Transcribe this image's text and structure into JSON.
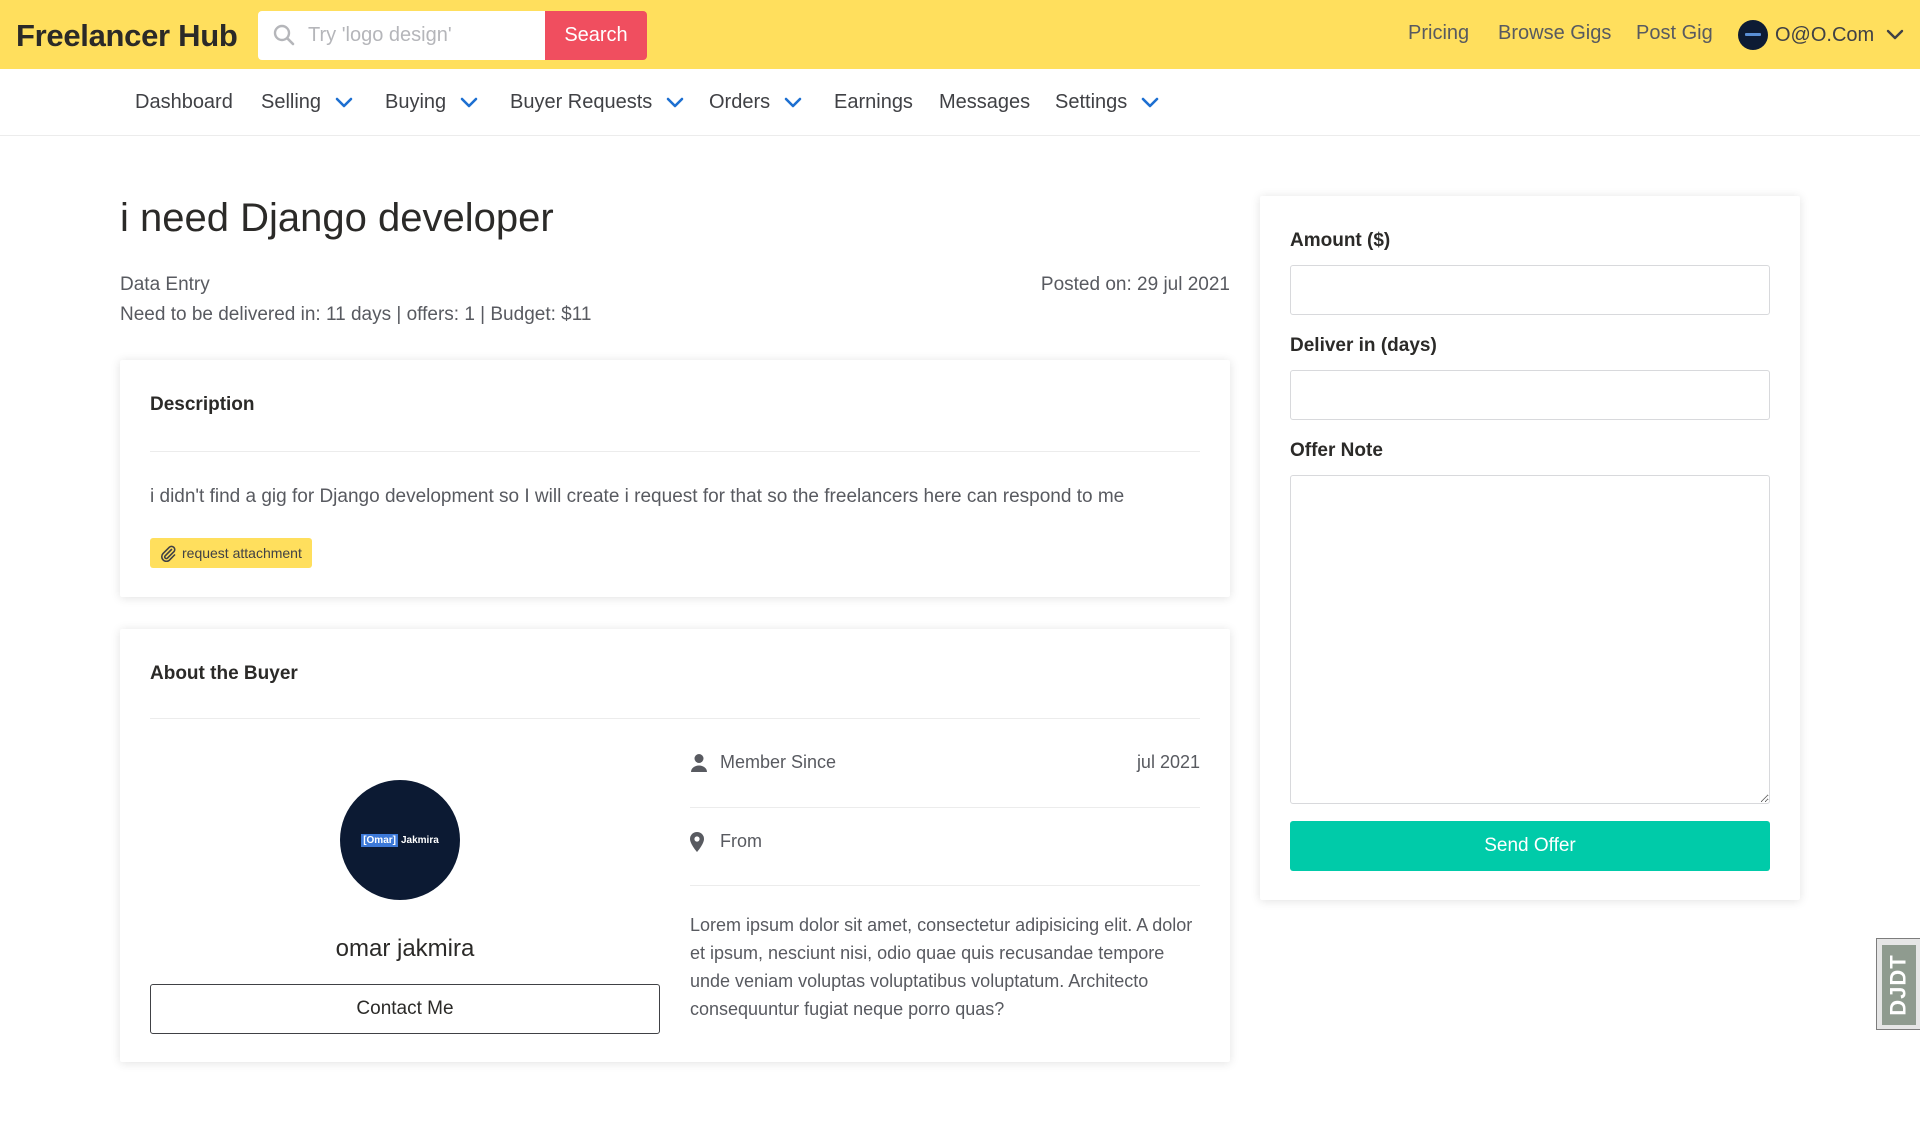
{
  "header": {
    "brand": "Freelancer Hub",
    "search_placeholder": "Try 'logo design'",
    "search_button": "Search",
    "links": [
      "Pricing",
      "Browse Gigs",
      "Post Gig"
    ],
    "account_label": "O@O.Com"
  },
  "nav": {
    "items": [
      {
        "label": "Dashboard",
        "dropdown": false
      },
      {
        "label": "Selling",
        "dropdown": true
      },
      {
        "label": "Buying",
        "dropdown": true
      },
      {
        "label": "Buyer Requests",
        "dropdown": true
      },
      {
        "label": "Orders",
        "dropdown": true
      },
      {
        "label": "Earnings",
        "dropdown": false
      },
      {
        "label": "Messages",
        "dropdown": false
      },
      {
        "label": "Settings",
        "dropdown": true
      }
    ]
  },
  "request": {
    "title": "i need Django developer",
    "category": "Data Entry",
    "posted_on": "Posted on: 29 jul 2021",
    "delivery_line": "Need to be delivered in: 11 days | offers: 1 | Budget: $11"
  },
  "description": {
    "heading": "Description",
    "text": "i didn't find a gig for Django development so I will create i request for that so the freelancers here can respond to me",
    "attachment_label": "request attachment"
  },
  "buyer": {
    "heading": "About the Buyer",
    "avatar_logo_highlight": "[Omar]",
    "avatar_logo_text": "Jakmira",
    "name": "omar jakmira",
    "contact_button": "Contact Me",
    "member_since_label": "Member Since",
    "member_since_value": "jul 2021",
    "from_label": "From",
    "from_value": "",
    "bio": "Lorem ipsum dolor sit amet, consectetur adipisicing elit. A dolor et ipsum, nesciunt nisi, odio quae quis recusandae tempore unde veniam voluptas voluptatibus voluptatum. Architecto consequuntur fugiat neque porro quas?"
  },
  "offer_form": {
    "amount_label": "Amount ($)",
    "amount_value": "",
    "deliver_label": "Deliver in (days)",
    "deliver_value": "",
    "note_label": "Offer Note",
    "note_value": "",
    "send_button": "Send Offer"
  },
  "debug_toolbar": {
    "label": "DJDT"
  },
  "colors": {
    "header_bg": "#ffdf5d",
    "search_button": "#f04e5f",
    "send_button": "#00cba9",
    "nav_chevron": "#1d6fd1"
  }
}
